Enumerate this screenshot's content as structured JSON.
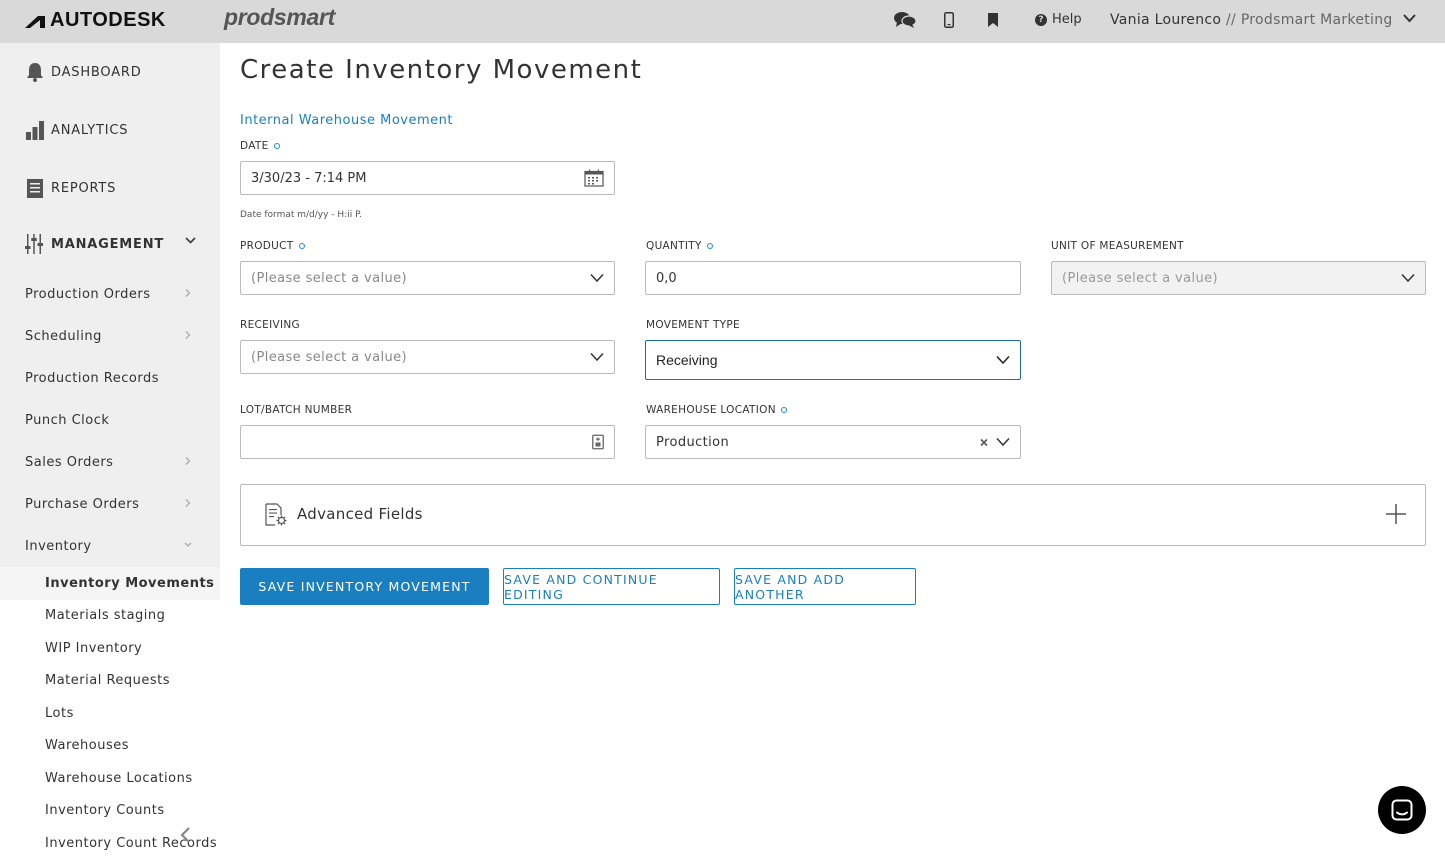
{
  "topbar": {
    "brand": "AUTODESK",
    "product": "prodsmart",
    "help_label": "Help",
    "user_name": "Vania Lourenco",
    "user_org": "// Prodsmart Marketing"
  },
  "sidebar": {
    "main": [
      {
        "label": "DASHBOARD",
        "icon": "bell-icon"
      },
      {
        "label": "ANALYTICS",
        "icon": "bar-chart-icon"
      },
      {
        "label": "REPORTS",
        "icon": "document-icon"
      }
    ],
    "management_label": "MANAGEMENT",
    "items": [
      {
        "label": "Production Orders",
        "has_arrow": true
      },
      {
        "label": "Scheduling",
        "has_arrow": true
      },
      {
        "label": "Production Records",
        "has_arrow": false
      },
      {
        "label": "Punch Clock",
        "has_arrow": false
      },
      {
        "label": "Sales Orders",
        "has_arrow": true
      },
      {
        "label": "Purchase Orders",
        "has_arrow": true
      },
      {
        "label": "Inventory",
        "has_arrow": true
      }
    ],
    "sub_items": [
      {
        "label": "Inventory Movements",
        "active": true
      },
      {
        "label": "Materials staging"
      },
      {
        "label": "WIP Inventory"
      },
      {
        "label": "Material Requests"
      },
      {
        "label": "Lots"
      },
      {
        "label": "Warehouses"
      },
      {
        "label": "Warehouse Locations"
      },
      {
        "label": "Inventory Counts"
      },
      {
        "label": "Inventory Count Records"
      }
    ]
  },
  "main": {
    "title": "Create Inventory Movement",
    "section_link": "Internal Warehouse Movement",
    "date": {
      "label": "DATE",
      "value": "3/30/23 - 7:14 PM",
      "hint": "Date format m/d/yy - H:ii P."
    },
    "product": {
      "label": "PRODUCT",
      "placeholder": "(Please select a value)"
    },
    "quantity": {
      "label": "QUANTITY",
      "value": "0,0"
    },
    "unit": {
      "label": "UNIT OF MEASUREMENT",
      "placeholder": "(Please select a value)"
    },
    "receiving": {
      "label": "RECEIVING",
      "placeholder": "(Please select a value)"
    },
    "movement_type": {
      "label": "MOVEMENT TYPE",
      "value": "Receiving"
    },
    "lot": {
      "label": "LOT/BATCH NUMBER",
      "value": ""
    },
    "warehouse_location": {
      "label": "WAREHOUSE LOCATION",
      "value": "Production"
    },
    "advanced": {
      "label": "Advanced Fields"
    },
    "buttons": {
      "save": "SAVE INVENTORY MOVEMENT",
      "save_continue": "SAVE AND CONTINUE EDITING",
      "save_add": "SAVE AND ADD ANOTHER"
    }
  },
  "colors": {
    "accent": "#1a7fc1",
    "required_dot": "#1a8fd6",
    "topbar": "#d9d9d9",
    "sidebar_bg": "#efefef"
  }
}
